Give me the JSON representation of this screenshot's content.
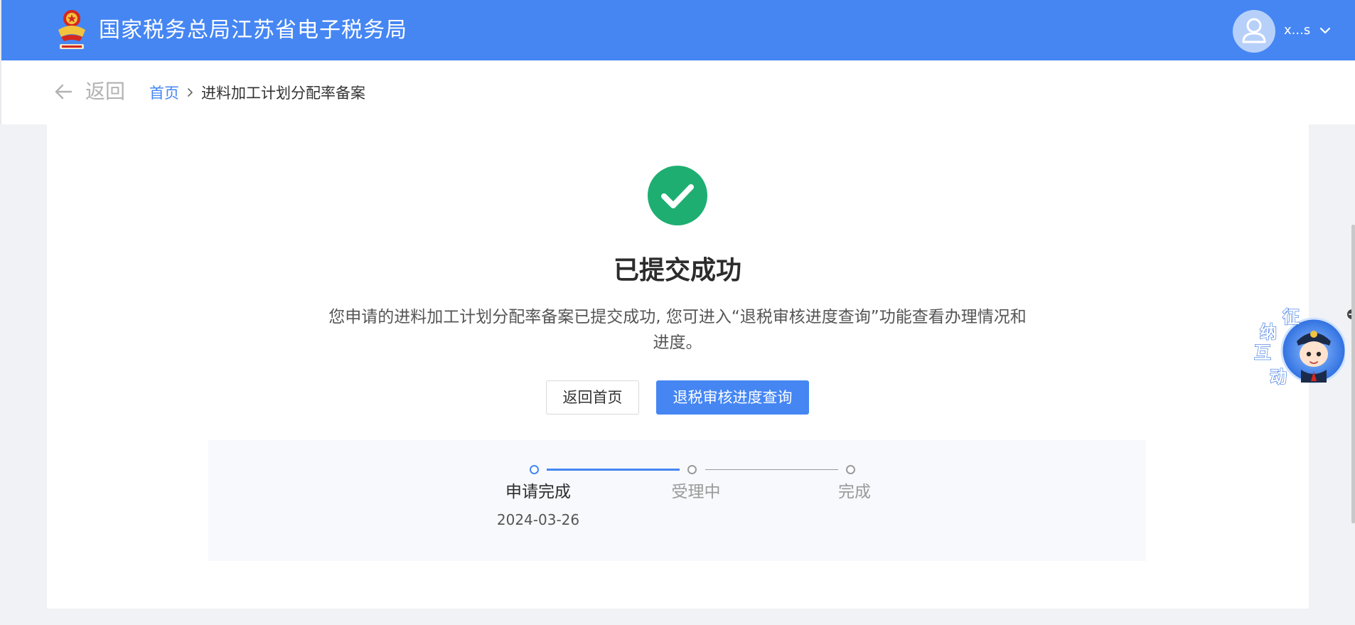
{
  "header": {
    "site_title": "国家税务总局江苏省电子税务局",
    "user_name": "x...s",
    "emblem_icon": "tax-emblem-icon",
    "avatar_icon": "user-avatar-icon",
    "menu_icon": "chevron-down-icon"
  },
  "breadcrumb": {
    "back_label": "返回",
    "home_label": "首页",
    "current_label": "进料加工计划分配率备案",
    "back_icon": "arrow-left-icon",
    "separator_icon": "chevron-right-icon"
  },
  "result": {
    "status_icon": "check-circle-icon",
    "title": "已提交成功",
    "description": "您申请的进料加工计划分配率备案已提交成功, 您可进入“退税审核进度查询”功能查看办理情况和进度。"
  },
  "actions": {
    "home_button": "返回首页",
    "query_button": "退税审核进度查询"
  },
  "steps": [
    {
      "label": "申请完成",
      "date": "2024-03-26",
      "status": "done"
    },
    {
      "label": "受理中",
      "date": "",
      "status": "pending"
    },
    {
      "label": "完成",
      "date": "",
      "status": "pending"
    }
  ],
  "float_widget": {
    "chars": [
      "征",
      "纳",
      "互",
      "动"
    ],
    "icon": "assistant-mascot-icon",
    "close_icon": "close-icon"
  },
  "colors": {
    "brand": "#4586f3",
    "success": "#1fae71",
    "text_primary": "#2c2c2c",
    "text_muted": "#9a9a9a"
  }
}
